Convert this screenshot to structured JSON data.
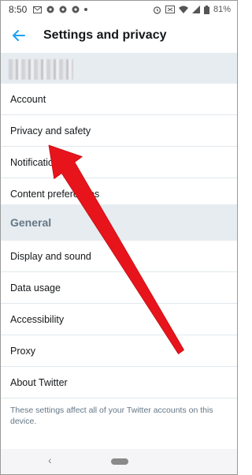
{
  "status_bar": {
    "time": "8:50",
    "battery": "81%",
    "left_icons": [
      "mail-icon",
      "app-icon",
      "app-icon",
      "app-icon",
      "dot-icon"
    ],
    "right_icons": [
      "alarm-icon",
      "cast-icon",
      "wifi-icon",
      "signal-icon",
      "battery-icon"
    ]
  },
  "header": {
    "title": "Settings and privacy",
    "accent_color": "#1da1f2"
  },
  "account_section": {
    "items": [
      {
        "label": "Account"
      },
      {
        "label": "Privacy and safety"
      },
      {
        "label": "Notifications"
      },
      {
        "label": "Content preferences"
      }
    ]
  },
  "general_section": {
    "title": "General",
    "items": [
      {
        "label": "Display and sound"
      },
      {
        "label": "Data usage"
      },
      {
        "label": "Accessibility"
      },
      {
        "label": "Proxy"
      },
      {
        "label": "About Twitter"
      }
    ]
  },
  "footer_note": "These settings affect all of your Twitter accounts on this device.",
  "annotation": {
    "arrow_color": "#e8141c"
  },
  "nav_bar": {
    "icons": [
      "nav-back-icon",
      "home-pill-icon"
    ]
  }
}
